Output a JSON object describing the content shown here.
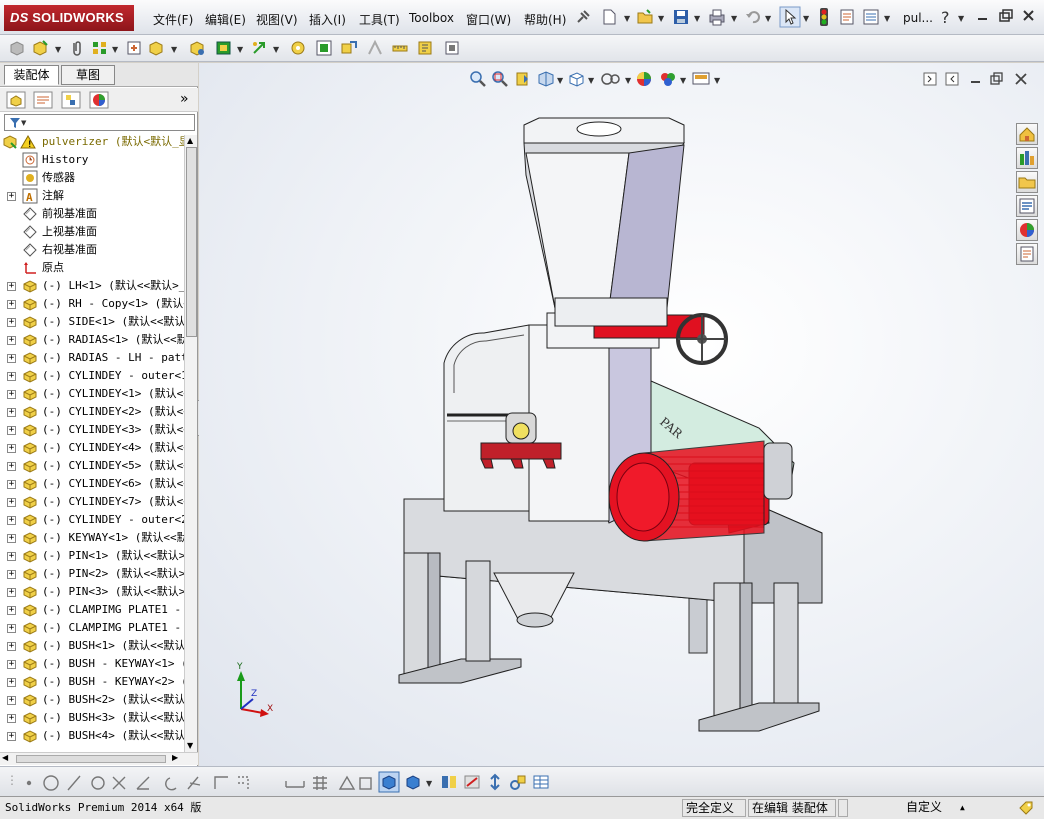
{
  "app": {
    "brand_ds": "DS",
    "brand_name": "SOLIDWORKS",
    "doc_title": "pul..."
  },
  "menu": [
    "文件(F)",
    "编辑(E)",
    "视图(V)",
    "插入(I)",
    "工具(T)",
    "Toolbox",
    "窗口(W)",
    "帮助(H)"
  ],
  "panel": {
    "tabs": [
      "装配体",
      "草图"
    ],
    "more": "»",
    "tree": [
      {
        "label": "pulverizer  (默认<默认_显",
        "plus": false,
        "icon": "assembly-icon",
        "color": "#7a6a00"
      },
      {
        "label": "History",
        "plus": false,
        "icon": "history-icon"
      },
      {
        "label": "传感器",
        "plus": false,
        "icon": "sensor-icon"
      },
      {
        "label": "注解",
        "plus": true,
        "icon": "annotation-icon"
      },
      {
        "label": "前视基准面",
        "plus": false,
        "icon": "plane-icon"
      },
      {
        "label": "上视基准面",
        "plus": false,
        "icon": "plane-icon"
      },
      {
        "label": "右视基准面",
        "plus": false,
        "icon": "plane-icon"
      },
      {
        "label": "原点",
        "plus": false,
        "icon": "origin-icon"
      },
      {
        "label": "(-) LH<1> (默认<<默认>_",
        "plus": true,
        "icon": "part-icon"
      },
      {
        "label": "(-) RH - Copy<1> (默认<",
        "plus": true,
        "icon": "part-icon"
      },
      {
        "label": "(-) SIDE<1> (默认<<默认",
        "plus": true,
        "icon": "part-icon"
      },
      {
        "label": "(-) RADIAS<1> (默认<<默",
        "plus": true,
        "icon": "part-icon"
      },
      {
        "label": "(-) RADIAS - LH - patti",
        "plus": true,
        "icon": "part-icon"
      },
      {
        "label": "(-) CYLINDEY - outer<1>",
        "plus": true,
        "icon": "part-icon"
      },
      {
        "label": "(-) CYLINDEY<1> (默认<<",
        "plus": true,
        "icon": "part-icon"
      },
      {
        "label": "(-) CYLINDEY<2> (默认<<",
        "plus": true,
        "icon": "part-icon"
      },
      {
        "label": "(-) CYLINDEY<3> (默认<<",
        "plus": true,
        "icon": "part-icon"
      },
      {
        "label": "(-) CYLINDEY<4> (默认<<",
        "plus": true,
        "icon": "part-icon"
      },
      {
        "label": "(-) CYLINDEY<5> (默认<<",
        "plus": true,
        "icon": "part-icon"
      },
      {
        "label": "(-) CYLINDEY<6> (默认<<",
        "plus": true,
        "icon": "part-icon"
      },
      {
        "label": "(-) CYLINDEY<7> (默认<<",
        "plus": true,
        "icon": "part-icon"
      },
      {
        "label": "(-) CYLINDEY - outer<2>",
        "plus": true,
        "icon": "part-icon"
      },
      {
        "label": "(-) KEYWAY<1> (默认<<默",
        "plus": true,
        "icon": "part-icon"
      },
      {
        "label": "(-) PIN<1> (默认<<默认>",
        "plus": true,
        "icon": "part-icon"
      },
      {
        "label": "(-) PIN<2> (默认<<默认>",
        "plus": true,
        "icon": "part-icon"
      },
      {
        "label": "(-) PIN<3> (默认<<默认>",
        "plus": true,
        "icon": "part-icon"
      },
      {
        "label": "(-) CLAMPIMG PLATE1 - 4",
        "plus": true,
        "icon": "part-icon"
      },
      {
        "label": "(-) CLAMPIMG PLATE1 - 4",
        "plus": true,
        "icon": "part-icon"
      },
      {
        "label": "(-) BUSH<1> (默认<<默认",
        "plus": true,
        "icon": "part-icon"
      },
      {
        "label": "(-) BUSH - KEYWAY<1> (默",
        "plus": true,
        "icon": "part-icon"
      },
      {
        "label": "(-) BUSH - KEYWAY<2> (默",
        "plus": true,
        "icon": "part-icon"
      },
      {
        "label": "(-) BUSH<2> (默认<<默认",
        "plus": true,
        "icon": "part-icon"
      },
      {
        "label": "(-) BUSH<3> (默认<<默认",
        "plus": true,
        "icon": "part-icon"
      },
      {
        "label": "(-) BUSH<4> (默认<<默认",
        "plus": true,
        "icon": "part-icon"
      }
    ]
  },
  "status": {
    "product": "SolidWorks Premium 2014 x64 版",
    "defined": "完全定义",
    "editing": "在编辑 装配体",
    "units": "自定义"
  },
  "colors": {
    "brand": "#b0242a",
    "motor_red": "#e0101e",
    "belt_guard": "#cfe8d8"
  }
}
